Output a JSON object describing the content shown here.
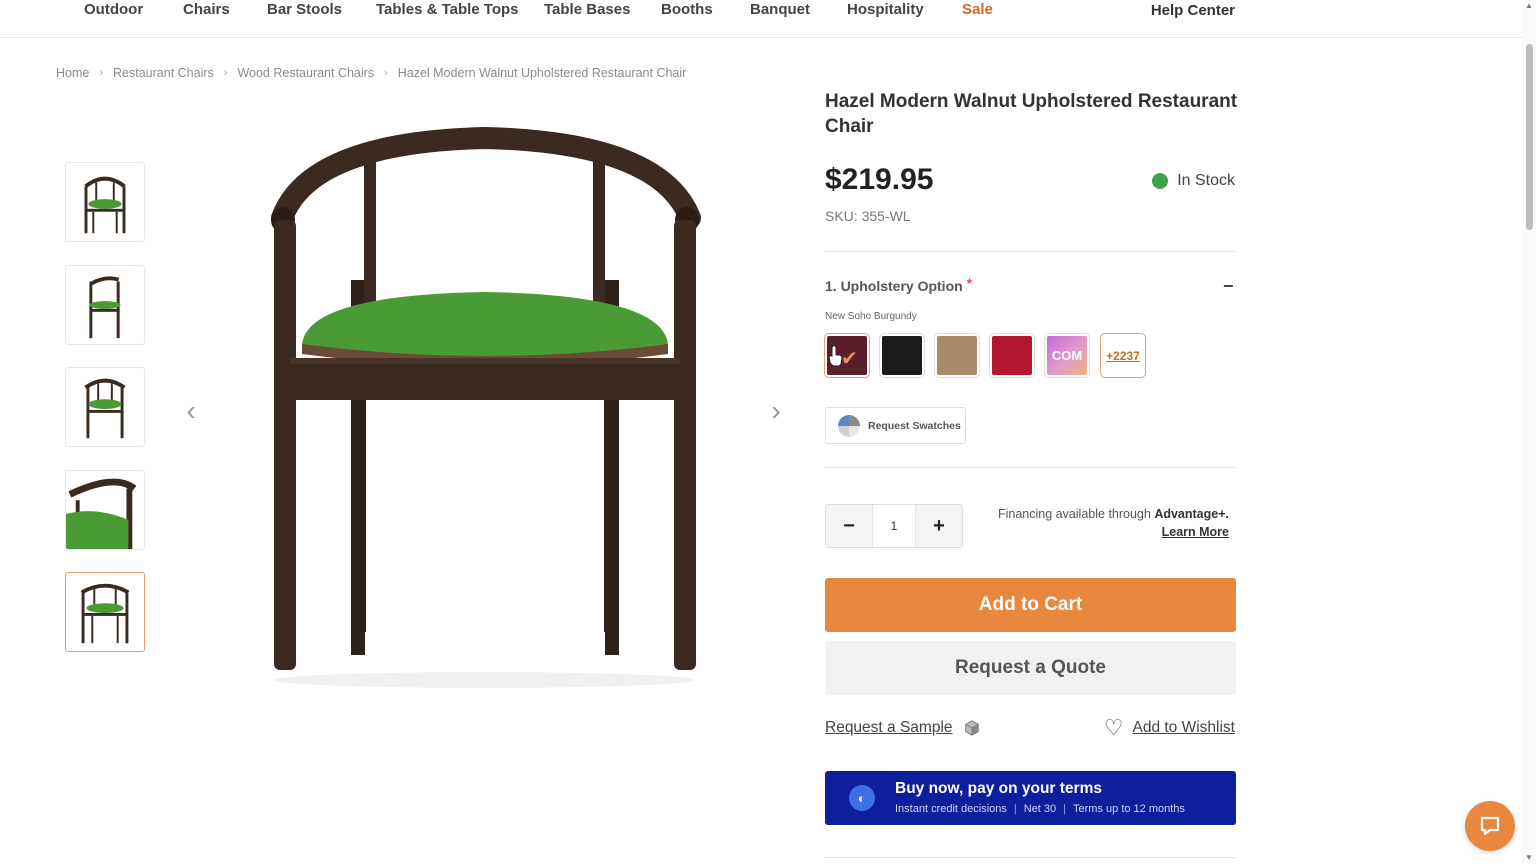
{
  "nav": {
    "items": [
      "Outdoor",
      "Chairs",
      "Bar Stools",
      "Tables & Table Tops",
      "Table Bases",
      "Booths",
      "Banquet",
      "Hospitality",
      "Sale"
    ],
    "help": "Help Center"
  },
  "breadcrumb": [
    "Home",
    "Restaurant Chairs",
    "Wood Restaurant Chairs",
    "Hazel Modern Walnut Upholstered Restaurant Chair"
  ],
  "product": {
    "title": "Hazel Modern Walnut Upholstered Restaurant Chair",
    "price": "$219.95",
    "stock": "In Stock",
    "sku": "SKU: 355-WL"
  },
  "option": {
    "title": "1. Upholstery Option",
    "required": "*",
    "collapse": "−",
    "selected": "New Soho Burgundy",
    "com_label": "COM",
    "more_label": "+2237",
    "swatch_colors": [
      "#5a1f2a",
      "#1b1b1b",
      "#a88a6a",
      "#b4172f"
    ]
  },
  "swatch_button": "Request Swatches",
  "quantity": {
    "minus": "−",
    "value": "1",
    "plus": "+"
  },
  "financing": {
    "text": "Financing available through ",
    "brand": "Advantage+.",
    "link": "Learn More"
  },
  "buttons": {
    "add_to_cart": "Add to Cart",
    "quote": "Request a Quote",
    "sample": "Request a Sample",
    "wishlist": "Add to Wishlist"
  },
  "promo": {
    "title": "Buy now, pay on your terms",
    "sub1": "Instant credit decisions",
    "sub2": "Net 30",
    "sub3": "Terms up to 12 months"
  },
  "colors": {
    "accent": "#e8883f",
    "seat_green": "#4a9a35",
    "walnut": "#3a2a22",
    "promo_blue": "#0d1f9c"
  },
  "icons": [
    "chevron-left-icon",
    "chevron-right-icon",
    "check-icon",
    "swatch-fan-icon",
    "cube-icon",
    "heart-icon",
    "chat-icon"
  ]
}
